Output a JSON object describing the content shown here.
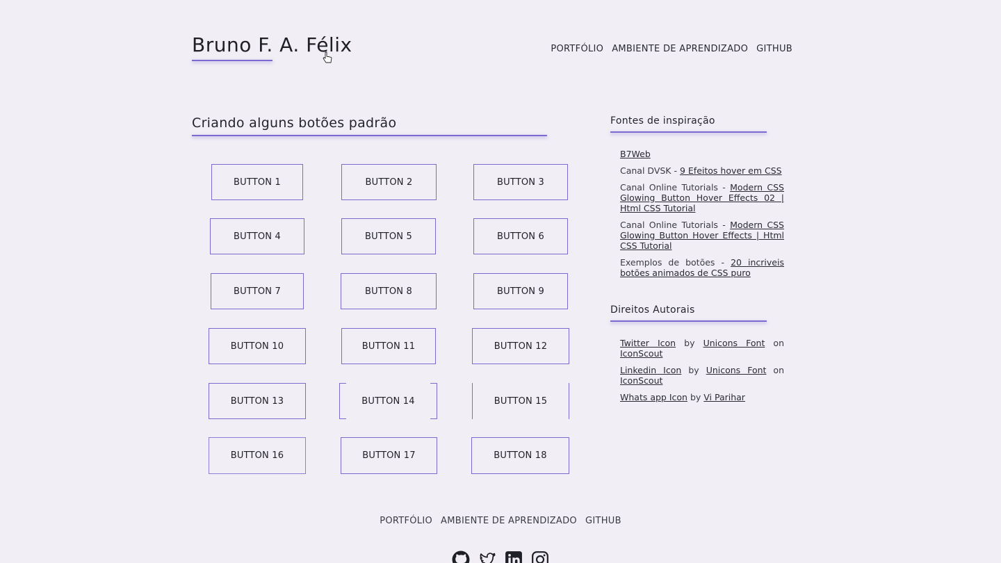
{
  "header": {
    "brand": "Bruno F. A. Félix",
    "nav": [
      "PORTFÓLIO",
      "AMBIENTE DE APRENDIZADO",
      "GITHUB"
    ]
  },
  "main": {
    "title": "Criando alguns botões padrão",
    "buttons": [
      "BUTTON 1",
      "BUTTON 2",
      "BUTTON 3",
      "BUTTON 4",
      "BUTTON 5",
      "BUTTON 6",
      "BUTTON 7",
      "BUTTON 8",
      "BUTTON 9",
      "BUTTON 10",
      "BUTTON 11",
      "BUTTON 12",
      "BUTTON 13",
      "BUTTON 14",
      "BUTTON 15",
      "BUTTON 16",
      "BUTTON 17",
      "BUTTON 18"
    ]
  },
  "sidebar": {
    "inspiration_title": "Fontes de inspiração",
    "inspiration": [
      {
        "prefix": "",
        "link": "B7Web"
      },
      {
        "prefix": "Canal DVSK - ",
        "link": "9 Efeitos hover em CSS"
      },
      {
        "prefix": "Canal Online Tutorials - ",
        "link": "Modern CSS Glowing Button Hover Effects 02 | Html CSS Tutorial"
      },
      {
        "prefix": "Canal Online Tutorials - ",
        "link": "Modern CSS Glowing Button Hover Effects | Html CSS Tutorial"
      },
      {
        "prefix": "Exemplos de botões - ",
        "link": "20 incriveis botões animados de CSS puro"
      }
    ],
    "copyright_title": "Direitos Autorais",
    "credits": [
      {
        "icon": "Twitter Icon",
        "by": " by ",
        "author": "Unicons Font",
        "on": " on ",
        "site": "IconScout"
      },
      {
        "icon": "Linkedin Icon",
        "by": " by ",
        "author": "Unicons Font",
        "on": " on ",
        "site": "IconScout"
      },
      {
        "icon": "Whats app Icon",
        "by": " by ",
        "author": "Vi Parihar",
        "on": "",
        "site": ""
      }
    ]
  },
  "footer": {
    "nav": [
      "PORTFÓLIO",
      "AMBIENTE DE APRENDIZADO",
      "GITHUB"
    ],
    "social_icons": [
      "github-icon",
      "twitter-icon",
      "linkedin-icon",
      "instagram-icon"
    ]
  },
  "colors": {
    "background": "#f1eef5",
    "accent": "#7b6bd0",
    "text": "#2a2a33"
  }
}
